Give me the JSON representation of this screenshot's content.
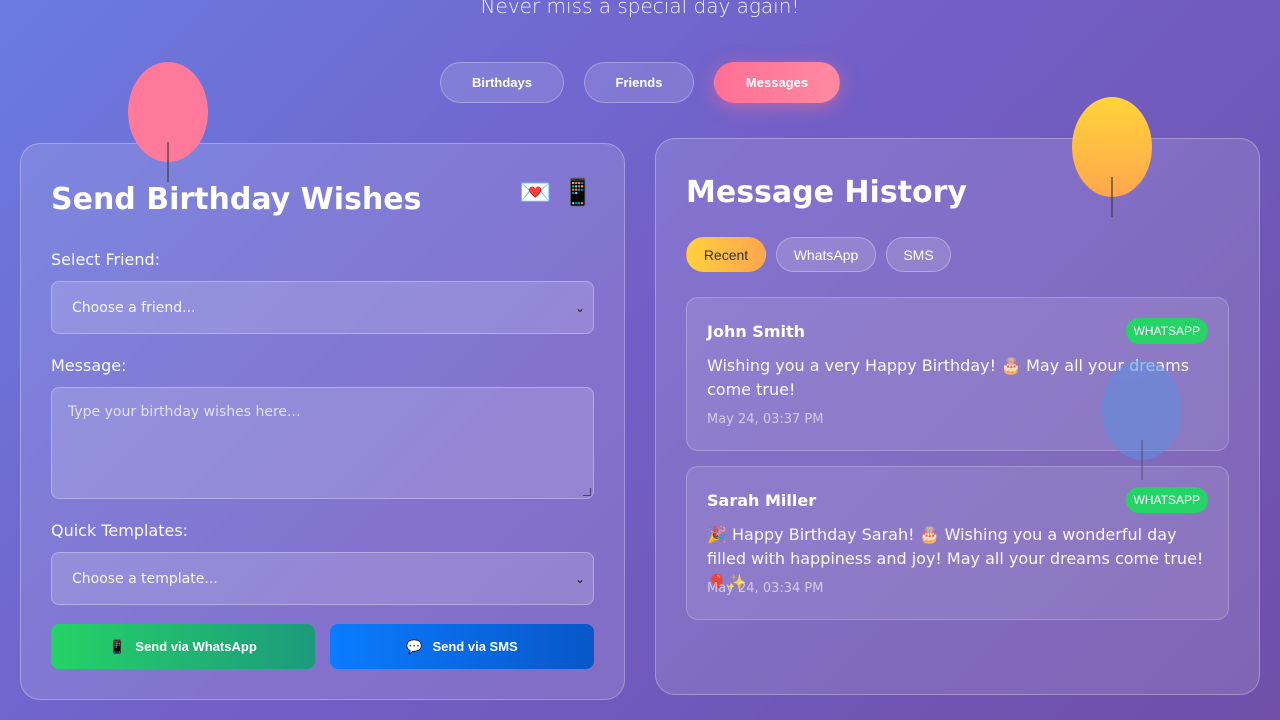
{
  "header": {
    "tagline": "Never miss a special day again!"
  },
  "nav": {
    "birthdays": "Birthdays",
    "friends": "Friends",
    "messages": "Messages"
  },
  "send": {
    "title": "Send Birthday Wishes",
    "icon_letter": "💌",
    "icon_phone": "📱",
    "friend_label": "Select Friend:",
    "friend_placeholder": "Choose a friend...",
    "message_label": "Message:",
    "message_placeholder": "Type your birthday wishes here...",
    "template_label": "Quick Templates:",
    "template_placeholder": "Choose a template...",
    "whatsapp_icon": "📱",
    "whatsapp_label": "Send via WhatsApp",
    "sms_icon": "💬",
    "sms_label": "Send via SMS"
  },
  "history": {
    "title": "Message History",
    "filters": [
      "Recent",
      "WhatsApp",
      "SMS"
    ],
    "messages": [
      {
        "name": "John Smith",
        "channel": "WHATSAPP",
        "text": "Wishing you a very Happy Birthday! 🎂 May all your dreams come true!",
        "time": "May 24, 03:37 PM"
      },
      {
        "name": "Sarah Miller",
        "channel": "WHATSAPP",
        "text": "🎉 Happy Birthday Sarah! 🎂 Wishing you a wonderful day filled with happiness and joy! May all your dreams come true! 🎈✨",
        "time": "May 24, 03:34 PM"
      }
    ]
  },
  "colors": {
    "accent_pink": "#ff6f95",
    "whatsapp_green": "#25d366",
    "sms_blue": "#0a7cff",
    "recent_yellow": "#ffd03c"
  }
}
